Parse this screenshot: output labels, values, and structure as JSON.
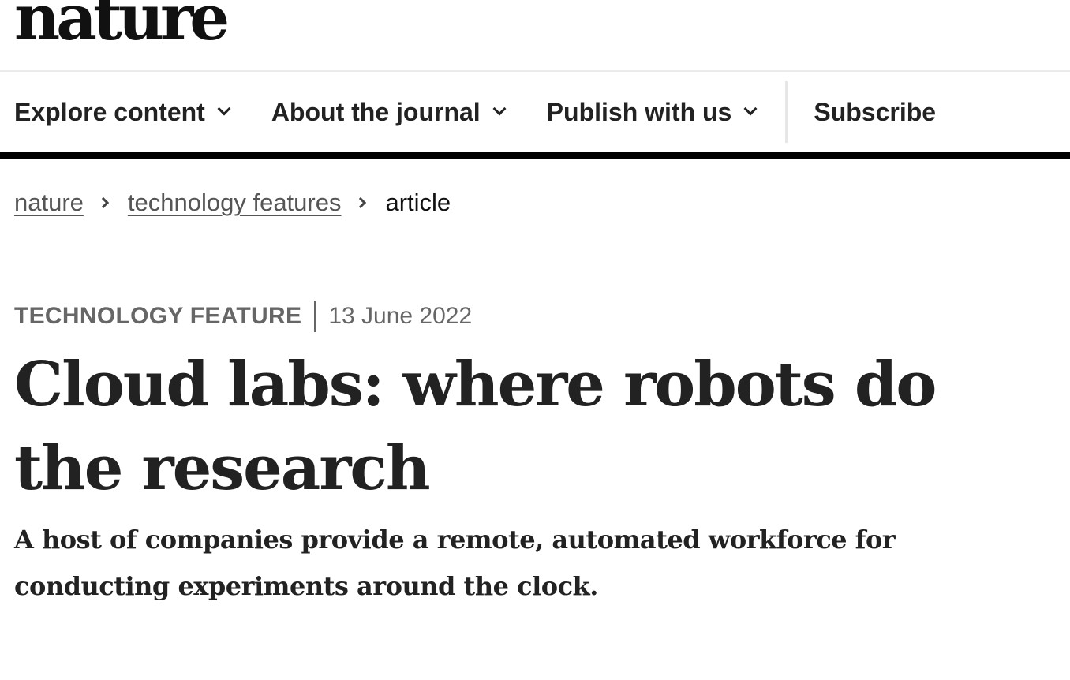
{
  "header": {
    "logo": "nature"
  },
  "nav": {
    "items": [
      {
        "label": "Explore content"
      },
      {
        "label": "About the journal"
      },
      {
        "label": "Publish with us"
      }
    ],
    "subscribe_label": "Subscribe",
    "icons": [
      "chevron-down-icon",
      "chevron-right-icon"
    ]
  },
  "breadcrumb": {
    "items": [
      "nature",
      "technology features"
    ],
    "current": "article"
  },
  "article": {
    "type": "TECHNOLOGY FEATURE",
    "date": "13 June 2022",
    "title": "Cloud labs: where robots do the research",
    "standfirst": "A host of companies provide a remote, automated workforce for conducting experiments around the clock."
  },
  "colors": {
    "text": "#222222",
    "meta_text": "#666666",
    "nav_border": "#000000",
    "background": "#ffffff"
  }
}
